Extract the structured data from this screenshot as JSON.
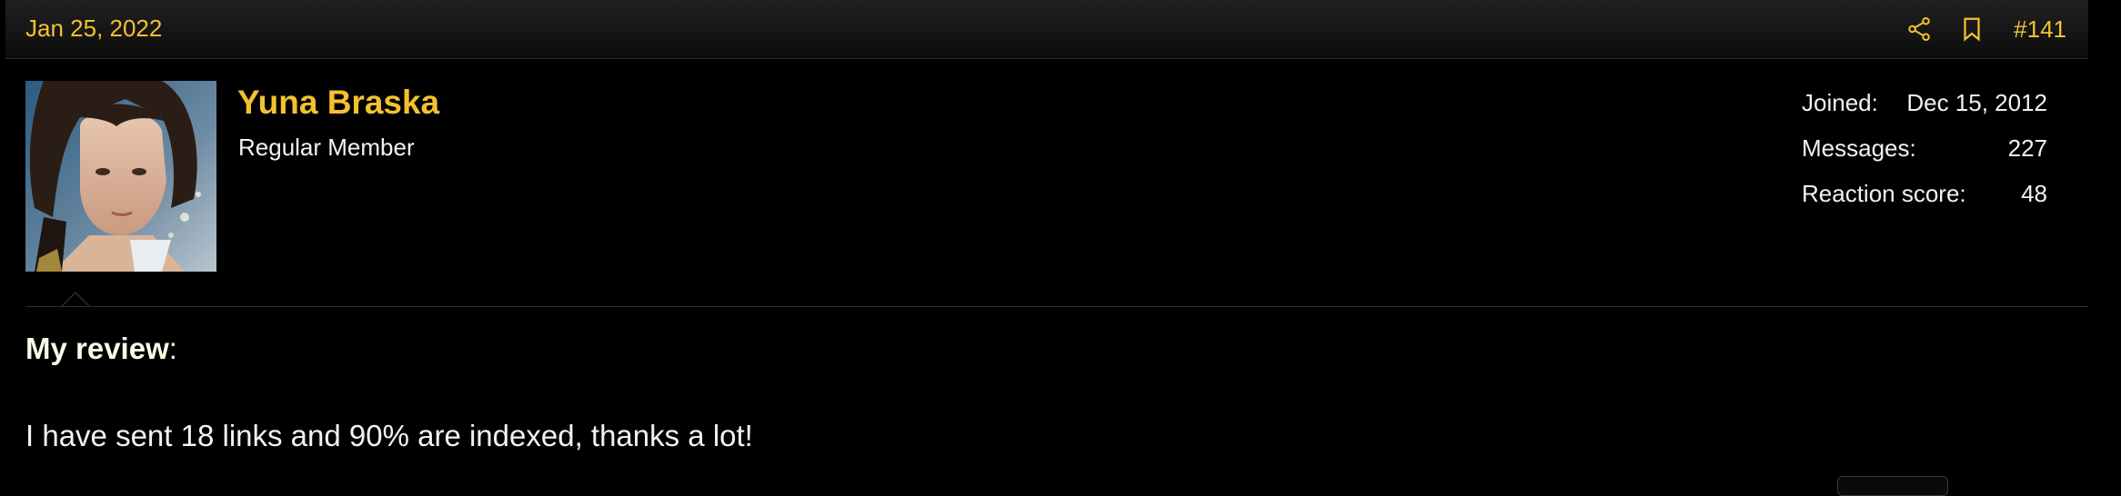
{
  "post": {
    "date": "Jan 25, 2022",
    "number": "#141",
    "icons": [
      "share-icon",
      "bookmark-icon"
    ]
  },
  "user": {
    "name": "Yuna Braska",
    "title": "Regular Member",
    "stats": [
      {
        "label": "Joined:",
        "value": "Dec 15, 2012"
      },
      {
        "label": "Messages:",
        "value": "227"
      },
      {
        "label": "Reaction score:",
        "value": "48"
      }
    ]
  },
  "content": {
    "heading": "My review",
    "heading_suffix": ":",
    "text": "I have sent 18 links and 90% are indexed, thanks a lot!"
  },
  "colors": {
    "accent": "#f3c130",
    "background": "#000000",
    "text": "#f2f2f2"
  }
}
